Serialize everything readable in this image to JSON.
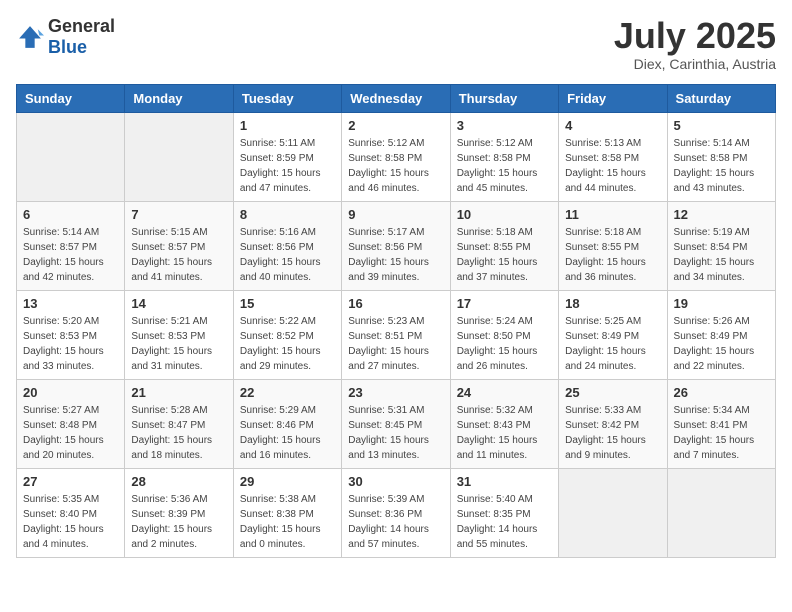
{
  "header": {
    "logo_general": "General",
    "logo_blue": "Blue",
    "month": "July 2025",
    "location": "Diex, Carinthia, Austria"
  },
  "weekdays": [
    "Sunday",
    "Monday",
    "Tuesday",
    "Wednesday",
    "Thursday",
    "Friday",
    "Saturday"
  ],
  "weeks": [
    [
      {
        "day": "",
        "info": ""
      },
      {
        "day": "",
        "info": ""
      },
      {
        "day": "1",
        "info": "Sunrise: 5:11 AM\nSunset: 8:59 PM\nDaylight: 15 hours\nand 47 minutes."
      },
      {
        "day": "2",
        "info": "Sunrise: 5:12 AM\nSunset: 8:58 PM\nDaylight: 15 hours\nand 46 minutes."
      },
      {
        "day": "3",
        "info": "Sunrise: 5:12 AM\nSunset: 8:58 PM\nDaylight: 15 hours\nand 45 minutes."
      },
      {
        "day": "4",
        "info": "Sunrise: 5:13 AM\nSunset: 8:58 PM\nDaylight: 15 hours\nand 44 minutes."
      },
      {
        "day": "5",
        "info": "Sunrise: 5:14 AM\nSunset: 8:58 PM\nDaylight: 15 hours\nand 43 minutes."
      }
    ],
    [
      {
        "day": "6",
        "info": "Sunrise: 5:14 AM\nSunset: 8:57 PM\nDaylight: 15 hours\nand 42 minutes."
      },
      {
        "day": "7",
        "info": "Sunrise: 5:15 AM\nSunset: 8:57 PM\nDaylight: 15 hours\nand 41 minutes."
      },
      {
        "day": "8",
        "info": "Sunrise: 5:16 AM\nSunset: 8:56 PM\nDaylight: 15 hours\nand 40 minutes."
      },
      {
        "day": "9",
        "info": "Sunrise: 5:17 AM\nSunset: 8:56 PM\nDaylight: 15 hours\nand 39 minutes."
      },
      {
        "day": "10",
        "info": "Sunrise: 5:18 AM\nSunset: 8:55 PM\nDaylight: 15 hours\nand 37 minutes."
      },
      {
        "day": "11",
        "info": "Sunrise: 5:18 AM\nSunset: 8:55 PM\nDaylight: 15 hours\nand 36 minutes."
      },
      {
        "day": "12",
        "info": "Sunrise: 5:19 AM\nSunset: 8:54 PM\nDaylight: 15 hours\nand 34 minutes."
      }
    ],
    [
      {
        "day": "13",
        "info": "Sunrise: 5:20 AM\nSunset: 8:53 PM\nDaylight: 15 hours\nand 33 minutes."
      },
      {
        "day": "14",
        "info": "Sunrise: 5:21 AM\nSunset: 8:53 PM\nDaylight: 15 hours\nand 31 minutes."
      },
      {
        "day": "15",
        "info": "Sunrise: 5:22 AM\nSunset: 8:52 PM\nDaylight: 15 hours\nand 29 minutes."
      },
      {
        "day": "16",
        "info": "Sunrise: 5:23 AM\nSunset: 8:51 PM\nDaylight: 15 hours\nand 27 minutes."
      },
      {
        "day": "17",
        "info": "Sunrise: 5:24 AM\nSunset: 8:50 PM\nDaylight: 15 hours\nand 26 minutes."
      },
      {
        "day": "18",
        "info": "Sunrise: 5:25 AM\nSunset: 8:49 PM\nDaylight: 15 hours\nand 24 minutes."
      },
      {
        "day": "19",
        "info": "Sunrise: 5:26 AM\nSunset: 8:49 PM\nDaylight: 15 hours\nand 22 minutes."
      }
    ],
    [
      {
        "day": "20",
        "info": "Sunrise: 5:27 AM\nSunset: 8:48 PM\nDaylight: 15 hours\nand 20 minutes."
      },
      {
        "day": "21",
        "info": "Sunrise: 5:28 AM\nSunset: 8:47 PM\nDaylight: 15 hours\nand 18 minutes."
      },
      {
        "day": "22",
        "info": "Sunrise: 5:29 AM\nSunset: 8:46 PM\nDaylight: 15 hours\nand 16 minutes."
      },
      {
        "day": "23",
        "info": "Sunrise: 5:31 AM\nSunset: 8:45 PM\nDaylight: 15 hours\nand 13 minutes."
      },
      {
        "day": "24",
        "info": "Sunrise: 5:32 AM\nSunset: 8:43 PM\nDaylight: 15 hours\nand 11 minutes."
      },
      {
        "day": "25",
        "info": "Sunrise: 5:33 AM\nSunset: 8:42 PM\nDaylight: 15 hours\nand 9 minutes."
      },
      {
        "day": "26",
        "info": "Sunrise: 5:34 AM\nSunset: 8:41 PM\nDaylight: 15 hours\nand 7 minutes."
      }
    ],
    [
      {
        "day": "27",
        "info": "Sunrise: 5:35 AM\nSunset: 8:40 PM\nDaylight: 15 hours\nand 4 minutes."
      },
      {
        "day": "28",
        "info": "Sunrise: 5:36 AM\nSunset: 8:39 PM\nDaylight: 15 hours\nand 2 minutes."
      },
      {
        "day": "29",
        "info": "Sunrise: 5:38 AM\nSunset: 8:38 PM\nDaylight: 15 hours\nand 0 minutes."
      },
      {
        "day": "30",
        "info": "Sunrise: 5:39 AM\nSunset: 8:36 PM\nDaylight: 14 hours\nand 57 minutes."
      },
      {
        "day": "31",
        "info": "Sunrise: 5:40 AM\nSunset: 8:35 PM\nDaylight: 14 hours\nand 55 minutes."
      },
      {
        "day": "",
        "info": ""
      },
      {
        "day": "",
        "info": ""
      }
    ]
  ]
}
